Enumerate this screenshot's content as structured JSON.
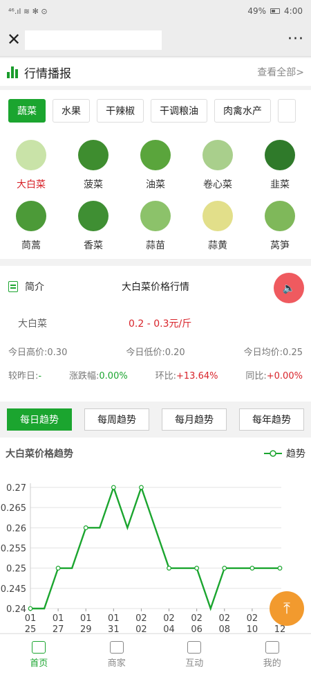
{
  "status": {
    "signal": "⁴⁶.ıl ≋ ✻ ⊙",
    "battery": "49%",
    "time": "4:00"
  },
  "nav": {
    "close_icon": "close-icon",
    "more": "···"
  },
  "news": {
    "title": "行情播报",
    "more": "查看全部>"
  },
  "categories": [
    {
      "label": "蔬菜",
      "active": true
    },
    {
      "label": "水果",
      "active": false
    },
    {
      "label": "干辣椒",
      "active": false
    },
    {
      "label": "干调粮油",
      "active": false
    },
    {
      "label": "肉禽水产",
      "active": false
    },
    {
      "label": "",
      "active": false
    }
  ],
  "vegetables": [
    {
      "name": "大白菜",
      "color": "#c9e3a8",
      "active": true
    },
    {
      "name": "菠菜",
      "color": "#3e8d2f",
      "active": false
    },
    {
      "name": "油菜",
      "color": "#5aa53c",
      "active": false
    },
    {
      "name": "卷心菜",
      "color": "#a9cf8c",
      "active": false
    },
    {
      "name": "韭菜",
      "color": "#2f7a2a",
      "active": false
    },
    {
      "name": "茼蒿",
      "color": "#4c9a38",
      "active": false
    },
    {
      "name": "香菜",
      "color": "#3f8f33",
      "active": false
    },
    {
      "name": "蒜苗",
      "color": "#8cc26a",
      "active": false
    },
    {
      "name": "蒜黄",
      "color": "#e2df8a",
      "active": false
    },
    {
      "name": "莴笋",
      "color": "#7fb85a",
      "active": false
    }
  ],
  "intro": {
    "label": "简介",
    "title": "大白菜价格行情",
    "item": "大白菜",
    "price": "0.2 - 0.3元/斤",
    "high_label": "今日高价:",
    "high": "0.30",
    "low_label": "今日低价:",
    "low": "0.20",
    "avg_label": "今日均价:",
    "avg": "0.25",
    "cmp_label": "较昨日:",
    "cmp": "-",
    "chg_label": "涨跌幅:",
    "chg": "0.00%",
    "mom_label": "环比:",
    "mom": "+13.64%",
    "yoy_label": "同比:",
    "yoy": "+0.00%"
  },
  "trend_tabs": [
    {
      "label": "每日趋势",
      "active": true
    },
    {
      "label": "每周趋势",
      "active": false
    },
    {
      "label": "每月趋势",
      "active": false
    },
    {
      "label": "每年趋势",
      "active": false
    }
  ],
  "chart_title": "大白菜价格趋势",
  "chart_data": {
    "type": "line",
    "title": "大白菜价格趋势",
    "series": [
      {
        "name": "趋势",
        "color": "#1ba52f",
        "values": [
          0.24,
          0.24,
          0.25,
          0.25,
          0.26,
          0.26,
          0.27,
          0.26,
          0.27,
          0.26,
          0.25,
          0.25,
          0.25,
          0.24,
          0.25,
          0.25,
          0.25,
          0.25,
          0.25
        ]
      }
    ],
    "x_ticks": [
      [
        "01",
        "25"
      ],
      [
        "01",
        "27"
      ],
      [
        "01",
        "29"
      ],
      [
        "01",
        "31"
      ],
      [
        "02",
        "02"
      ],
      [
        "02",
        "04"
      ],
      [
        "02",
        "06"
      ],
      [
        "02",
        "08"
      ],
      [
        "02",
        "10"
      ],
      [
        "02",
        "12"
      ]
    ],
    "y_ticks": [
      "0.27",
      "0.265",
      "0.26",
      "0.255",
      "0.25",
      "0.245",
      "0.24"
    ],
    "ylim": [
      0.24,
      0.27
    ]
  },
  "fab_icon": "back-to-top-icon",
  "tabbar": [
    {
      "label": "首页",
      "icon": "home-icon",
      "active": true
    },
    {
      "label": "商家",
      "icon": "store-icon",
      "active": false
    },
    {
      "label": "互动",
      "icon": "chat-icon",
      "active": false
    },
    {
      "label": "我的",
      "icon": "user-icon",
      "active": false
    }
  ]
}
